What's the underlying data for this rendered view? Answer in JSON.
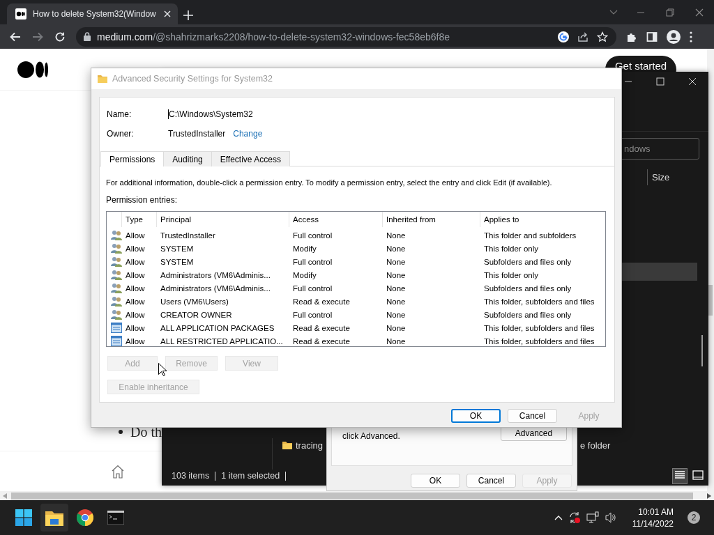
{
  "browser": {
    "tab_title": "How to delete System32(Window",
    "url_host": "medium.com",
    "url_path": "/@shahrizmarks2208/how-to-delete-system32-windows-fec58eb6f8e"
  },
  "article": {
    "action_button": "Get started",
    "list_item": "Do th"
  },
  "explorer": {
    "search_text": "ndows",
    "column": "Size",
    "file": {
      "name": "tracing",
      "type": "e folder"
    },
    "status": [
      "103 items",
      "1 item selected"
    ]
  },
  "properties": {
    "hint": "click Advanced.",
    "advanced_button": "Advanced",
    "buttons": [
      {
        "label": "OK",
        "disabled": false
      },
      {
        "label": "Cancel",
        "disabled": false
      },
      {
        "label": "Apply",
        "disabled": true
      }
    ]
  },
  "security": {
    "title": "Advanced Security Settings for System32",
    "fields": [
      {
        "label": "Name:",
        "value": "C:\\Windows\\System32",
        "focused": true
      },
      {
        "label": "Owner:",
        "value": "TrustedInstaller",
        "link": "Change",
        "focused": false
      }
    ],
    "tabs": [
      {
        "label": "Permissions",
        "selected": true
      },
      {
        "label": "Auditing",
        "selected": false
      },
      {
        "label": "Effective Access",
        "selected": false
      }
    ],
    "info": "For additional information, double-click a permission entry. To modify a permission entry, select the entry and click Edit (if available).",
    "entries_label": "Permission entries:",
    "columns": [
      "Type",
      "Principal",
      "Access",
      "Inherited from",
      "Applies to"
    ],
    "rows": [
      {
        "kind": "user",
        "type": "Allow",
        "principal": "TrustedInstaller",
        "access": "Full control",
        "inherited": "None",
        "applies": "This folder and subfolders"
      },
      {
        "kind": "user",
        "type": "Allow",
        "principal": "SYSTEM",
        "access": "Modify",
        "inherited": "None",
        "applies": "This folder only"
      },
      {
        "kind": "user",
        "type": "Allow",
        "principal": "SYSTEM",
        "access": "Full control",
        "inherited": "None",
        "applies": "Subfolders and files only"
      },
      {
        "kind": "user",
        "type": "Allow",
        "principal": "Administrators (VM6\\Adminis...",
        "access": "Modify",
        "inherited": "None",
        "applies": "This folder only"
      },
      {
        "kind": "user",
        "type": "Allow",
        "principal": "Administrators (VM6\\Adminis...",
        "access": "Full control",
        "inherited": "None",
        "applies": "Subfolders and files only"
      },
      {
        "kind": "user",
        "type": "Allow",
        "principal": "Users (VM6\\Users)",
        "access": "Read & execute",
        "inherited": "None",
        "applies": "This folder, subfolders and files"
      },
      {
        "kind": "user",
        "type": "Allow",
        "principal": "CREATOR OWNER",
        "access": "Full control",
        "inherited": "None",
        "applies": "Subfolders and files only"
      },
      {
        "kind": "package",
        "type": "Allow",
        "principal": "ALL APPLICATION PACKAGES",
        "access": "Read & execute",
        "inherited": "None",
        "applies": "This folder, subfolders and files"
      },
      {
        "kind": "package",
        "type": "Allow",
        "principal": "ALL RESTRICTED APPLICATIO...",
        "access": "Read & execute",
        "inherited": "None",
        "applies": "This folder, subfolders and files"
      }
    ],
    "actions": [
      {
        "label": "Add",
        "disabled": true
      },
      {
        "label": "Remove",
        "disabled": true
      },
      {
        "label": "View",
        "disabled": true
      }
    ],
    "inheritance_button": {
      "label": "Enable inheritance",
      "disabled": true
    },
    "buttons": [
      {
        "label": "OK",
        "default": true,
        "disabled": false
      },
      {
        "label": "Cancel",
        "default": false,
        "disabled": false
      },
      {
        "label": "Apply",
        "default": false,
        "disabled": true
      }
    ]
  },
  "taskbar": {
    "time": "10:01 AM",
    "date": "11/14/2022",
    "notification_count": "2"
  }
}
